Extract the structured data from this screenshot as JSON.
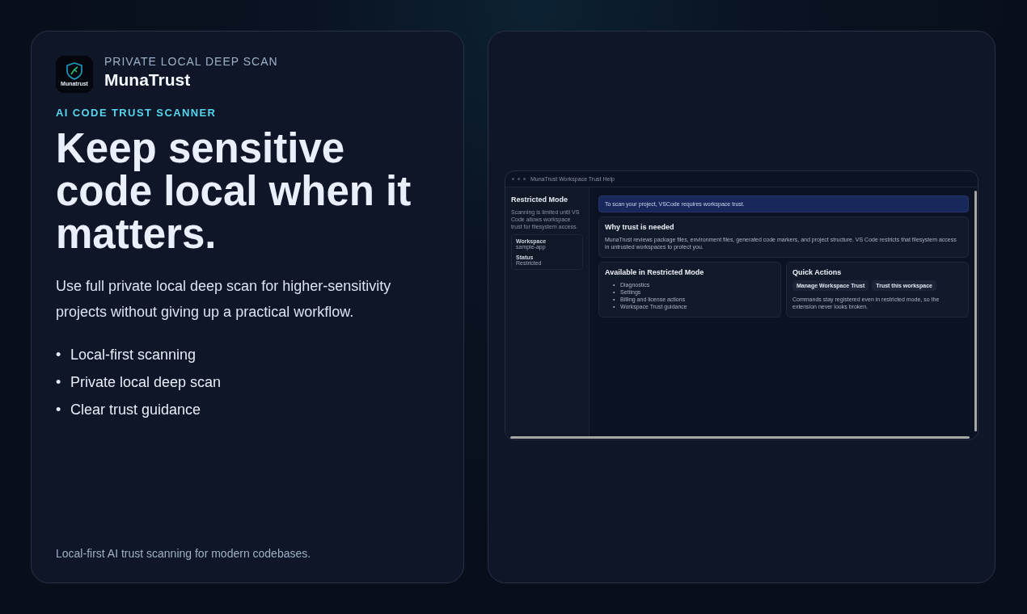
{
  "brand": {
    "logo_text": "Munatrust",
    "eyebrow": "PRIVATE LOCAL DEEP SCAN",
    "name": "MunaTrust"
  },
  "hero": {
    "kicker": "AI CODE TRUST SCANNER",
    "headline": "Keep sensitive code local when it matters.",
    "lead": "Use full private local deep scan for higher-sensitivity projects without giving up a practical workflow.",
    "bullets": [
      {
        "marker": "•",
        "text": "Local-first scanning"
      },
      {
        "marker": "•",
        "text": "Private local deep scan"
      },
      {
        "marker": "•",
        "text": "Clear trust guidance"
      }
    ],
    "footer": "Local-first AI trust scanning for modern codebases."
  },
  "preview": {
    "window_title": "MunaTrust Workspace Trust Help",
    "sidebar": {
      "title": "Restricted Mode",
      "text": "Scanning is limited until VS Code allows workspace trust for filesystem access.",
      "fields": [
        {
          "label": "Workspace",
          "value": "sample-app"
        },
        {
          "label": "Status",
          "value": "Restricted"
        }
      ]
    },
    "banner": "To scan your project, VSCode requires workspace trust.",
    "why": {
      "title": "Why trust is needed",
      "text": "MunaTrust reviews package files, environment files, generated code markers, and project structure. VS Code restricts that filesystem access in untrusted workspaces to protect you."
    },
    "available": {
      "title": "Available in Restricted Mode",
      "items": [
        {
          "marker": "•",
          "text": "Diagnostics"
        },
        {
          "marker": "•",
          "text": "Settings"
        },
        {
          "marker": "•",
          "text": "Billing and license actions"
        },
        {
          "marker": "•",
          "text": "Workspace Trust guidance"
        }
      ]
    },
    "actions": {
      "title": "Quick Actions",
      "buttons": [
        "Manage Workspace Trust",
        "Trust this workspace"
      ],
      "note": "Commands stay registered even in restricted mode, so the extension never looks broken."
    }
  }
}
